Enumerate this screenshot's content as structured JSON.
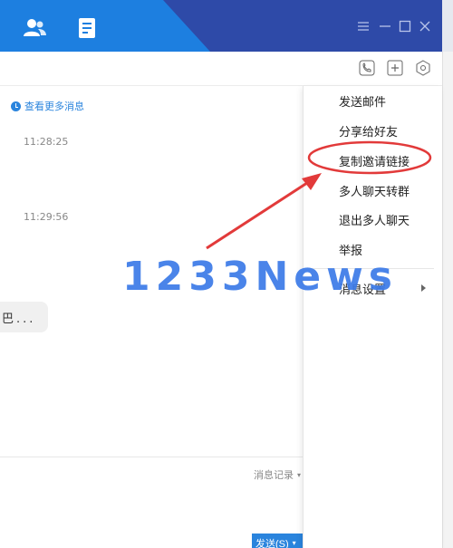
{
  "titlebar": {
    "icons": [
      "contacts-icon",
      "notes-icon"
    ],
    "window_controls": [
      "menu-icon",
      "minimize-icon",
      "maximize-icon",
      "close-icon"
    ],
    "colors": {
      "left": "#1d7fe0",
      "right": "#2e4aa8"
    }
  },
  "toolbar2": {
    "buttons": [
      "phone-icon",
      "add-member-icon",
      "settings-hex-icon"
    ]
  },
  "chat": {
    "more_messages": "查看更多消息",
    "timestamps": [
      "11:28:25",
      "11:29:56"
    ],
    "bubble_text": "巴..."
  },
  "input": {
    "history_label": "消息记录",
    "send_label": "发送(S)"
  },
  "menu": {
    "items": [
      "发送邮件",
      "分享给好友",
      "复制邀请链接",
      "多人聊天转群",
      "退出多人聊天",
      "举报",
      "消息设置"
    ]
  },
  "watermark": "1233News",
  "accent_color": "#2a84dd",
  "annotation_color": "#e23a3a"
}
